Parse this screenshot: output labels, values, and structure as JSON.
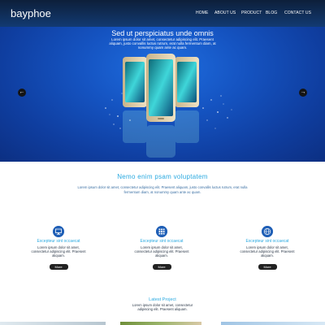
{
  "header": {
    "brand": "bayphoe",
    "nav": [
      "HOME",
      "ABOUT US",
      "PRODUCT",
      "BLOG",
      "CONTACT US"
    ]
  },
  "hero": {
    "title": "Sed ut perspiciatus unde omnis",
    "text": "Lorem ipsum dolor sit amet, consectetur adipiscing elit. Praesent aliquam, justo convallis luctus rutrum, erat nulla fermentum diam, at nonummy quam ante ac quam.",
    "prev": "←",
    "next": "→"
  },
  "intro": {
    "title": "Nemo enim psam voluptatem",
    "text": "Lorem ipsum dolor sit amet, consectetur adipiscing elit. Praesent aliquam, justo convallis luctus rutrum, erat nulla fermentum diam, at nonummy quam ante ac quam."
  },
  "features": [
    {
      "title": "Excepteur sint occaecat",
      "text": "Lorem ipsum dolor sit amet, consectetur adipiscing elit. Praesent aliquam.",
      "button": "More",
      "icon": "monitor-icon"
    },
    {
      "title": "Excepteur sint occaecat",
      "text": "Lorem ipsum dolor sit amet, consectetur adipiscing elit. Praesent aliquam.",
      "button": "More",
      "icon": "grid-icon"
    },
    {
      "title": "Excepteur sint occaecat",
      "text": "Lorem ipsum dolor sit amet, consectetur adipiscing elit. Praesent aliquam.",
      "button": "More",
      "icon": "globe-icon"
    }
  ],
  "project": {
    "title": "Latest Project",
    "text": "Lorem ipsum dolor sit amet, consectetur adipiscing elit. Praesent aliquam."
  },
  "colors": {
    "accent": "#2aa9e0",
    "hero": "#1554c2",
    "header": "#0d1f3a"
  }
}
